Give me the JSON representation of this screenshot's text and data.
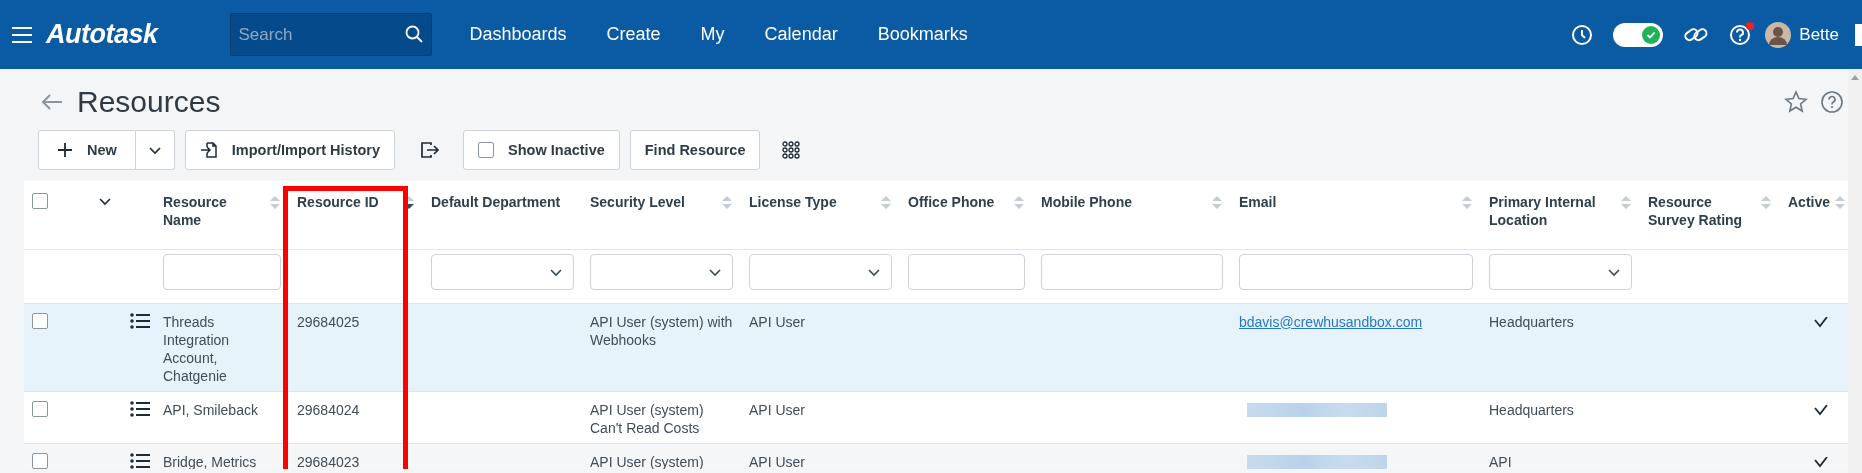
{
  "app": {
    "logo": "Autotask",
    "search": {
      "placeholder": "Search"
    },
    "nav": [
      "Dashboards",
      "Create",
      "My",
      "Calendar",
      "Bookmarks"
    ],
    "toggle": {
      "on": true
    },
    "help_alert": true,
    "user": "Bette"
  },
  "page": {
    "title": "Resources"
  },
  "toolbar": {
    "new": "New",
    "import": "Import/Import History",
    "show_inactive": {
      "label": "Show Inactive",
      "checked": false
    },
    "find": "Find Resource"
  },
  "table": {
    "all_selected": false,
    "columns": [
      {
        "label": "Resource Name",
        "kind": "text",
        "sortable": true
      },
      {
        "label": "Resource ID",
        "kind": "none",
        "sortable": true,
        "sorted": true,
        "highlighted": true
      },
      {
        "label": "Default Department",
        "kind": "select"
      },
      {
        "label": "Security Level",
        "kind": "select",
        "sortable": true
      },
      {
        "label": "License Type",
        "kind": "select",
        "sortable": true
      },
      {
        "label": "Office Phone",
        "kind": "text",
        "sortable": true
      },
      {
        "label": "Mobile Phone",
        "kind": "text",
        "sortable": true
      },
      {
        "label": "Email",
        "kind": "text",
        "sortable": true
      },
      {
        "label": "Primary Internal Location",
        "kind": "select",
        "sortable": true
      },
      {
        "label": "Resource Survey Rating",
        "kind": "none",
        "sortable": true
      },
      {
        "label": "Active",
        "kind": "none",
        "sortable": true
      }
    ],
    "rows": [
      {
        "selected": false,
        "highlighted": true,
        "name": "Threads Integration Account, Chatgenie",
        "id": "29684025",
        "security_level": "API User (system) with Webhooks",
        "license_type": "API User",
        "email": "bdavis@crewhusandbox.com",
        "location": "Headquarters",
        "active": true
      },
      {
        "selected": false,
        "highlighted": false,
        "name": "API, Smileback",
        "id": "29684024",
        "security_level": "API User (system) Can't Read Costs",
        "license_type": "API User",
        "email_redacted": true,
        "location": "Headquarters",
        "active": true
      },
      {
        "selected": false,
        "highlighted": false,
        "name": "Bridge, Metrics",
        "id": "29684023",
        "security_level": "API User (system)",
        "license_type": "API User",
        "email_redacted": true,
        "location": "API",
        "active": true
      }
    ]
  }
}
